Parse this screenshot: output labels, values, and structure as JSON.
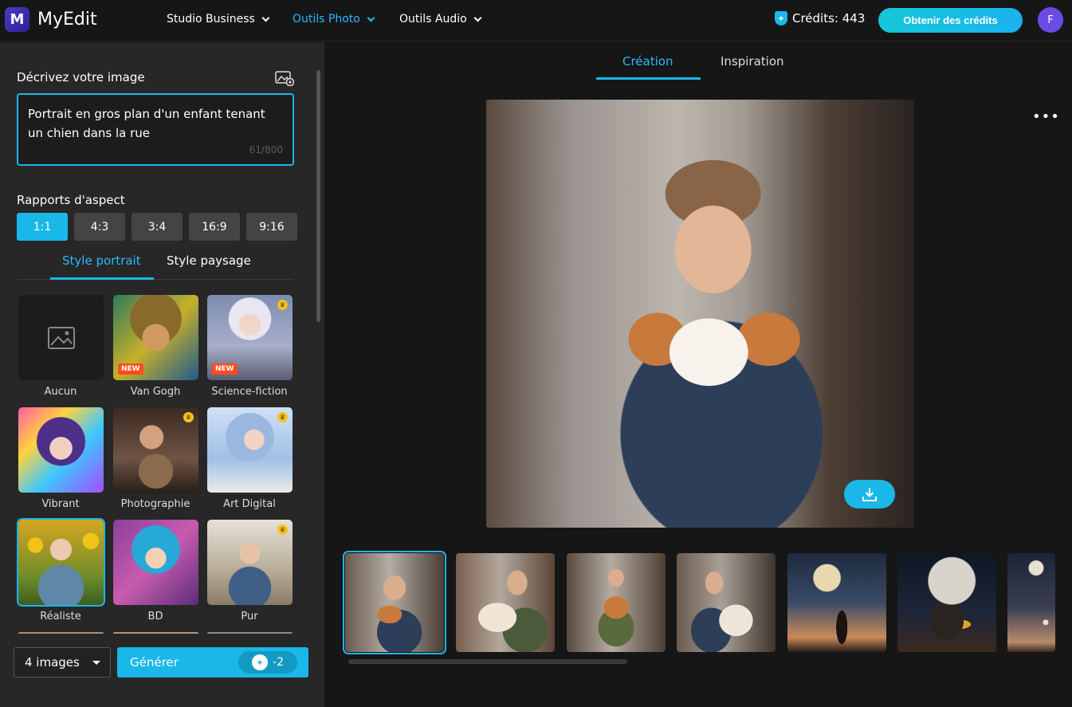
{
  "header": {
    "app_name": "MyEdit",
    "nav": [
      "Studio Business",
      "Outils Photo",
      "Outils Audio"
    ],
    "credits_label": "Crédits: 443",
    "get_credits_label": "Obtenir des crédits",
    "avatar_initial": "F"
  },
  "sidebar": {
    "describe_label": "Décrivez votre image",
    "prompt_value": "Portrait en gros plan d'un enfant tenant un chien dans la rue",
    "prompt_counter": "61/800",
    "aspect_label": "Rapports d'aspect",
    "ratios": [
      "1:1",
      "4:3",
      "3:4",
      "16:9",
      "9:16"
    ],
    "style_tabs": [
      "Style portrait",
      "Style paysage"
    ],
    "styles": [
      "Aucun",
      "Van Gogh",
      "Science-fiction",
      "Vibrant",
      "Photographie",
      "Art Digital",
      "Réaliste",
      "BD",
      "Pur"
    ],
    "new_badge": "NEW",
    "image_count": "4 images",
    "generate_label": "Générer",
    "generate_cost": "-2"
  },
  "main": {
    "tabs": [
      "Création",
      "Inspiration"
    ],
    "more_label": "•••"
  }
}
